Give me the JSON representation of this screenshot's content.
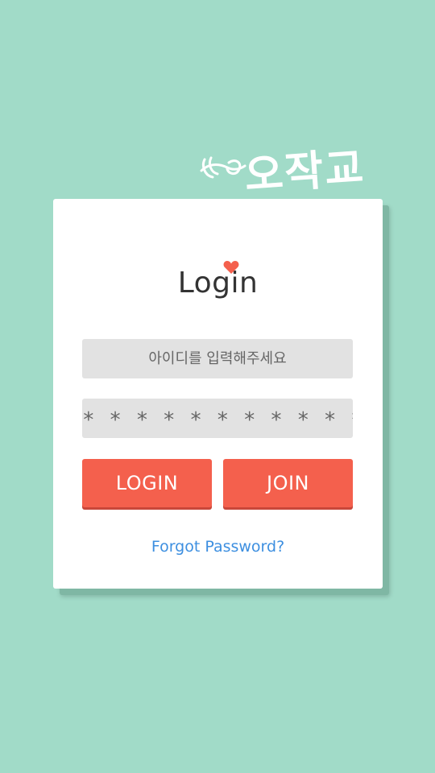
{
  "brand": {
    "name": "오작교",
    "mark_icon": "arrow-heart-icon"
  },
  "login": {
    "title": "Login",
    "title_icon": "heart-icon",
    "id_placeholder": "아이디를 입력해주세요",
    "password_mask": "* * * * * * * * * * * *",
    "login_button": "LOGIN",
    "join_button": "JOIN",
    "forgot_link": "Forgot Password?"
  },
  "colors": {
    "background": "#a1dbc8",
    "accent": "#f4604d",
    "link": "#3d8fe0",
    "field": "#e2e2e2"
  }
}
